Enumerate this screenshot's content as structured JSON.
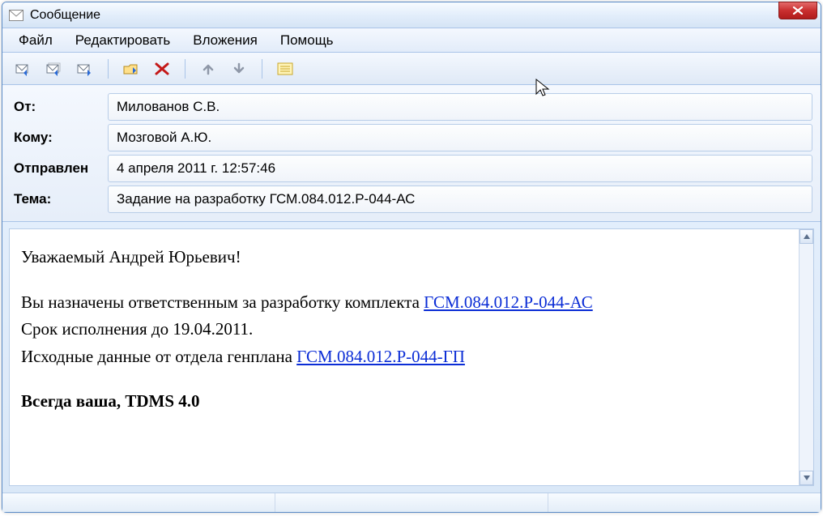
{
  "window": {
    "title": "Сообщение"
  },
  "menu": {
    "file": "Файл",
    "edit": "Редактировать",
    "attachments": "Вложения",
    "help": "Помощь"
  },
  "headers": {
    "from_label": "От:",
    "from_value": "Милованов С.В.",
    "to_label": "Кому:",
    "to_value": "Мозговой А.Ю.",
    "sent_label": "Отправлен",
    "sent_value": "4 апреля 2011 г. 12:57:46",
    "subject_label": "Тема:",
    "subject_value": "Задание на разработку ГСМ.084.012.Р-044-АС"
  },
  "body": {
    "greeting": "Уважаемый Андрей Юрьевич!",
    "line1_prefix": "Вы назначены ответственным за разработку комплекта ",
    "link1": "ГСМ.084.012.Р-044-АС",
    "line2": "Срок исполнения до 19.04.2011.",
    "line3_prefix": "Исходные данные от отдела генплана  ",
    "link2": "ГСМ.084.012.Р-044-ГП",
    "signature": "Всегда ваша, TDMS 4.0"
  }
}
